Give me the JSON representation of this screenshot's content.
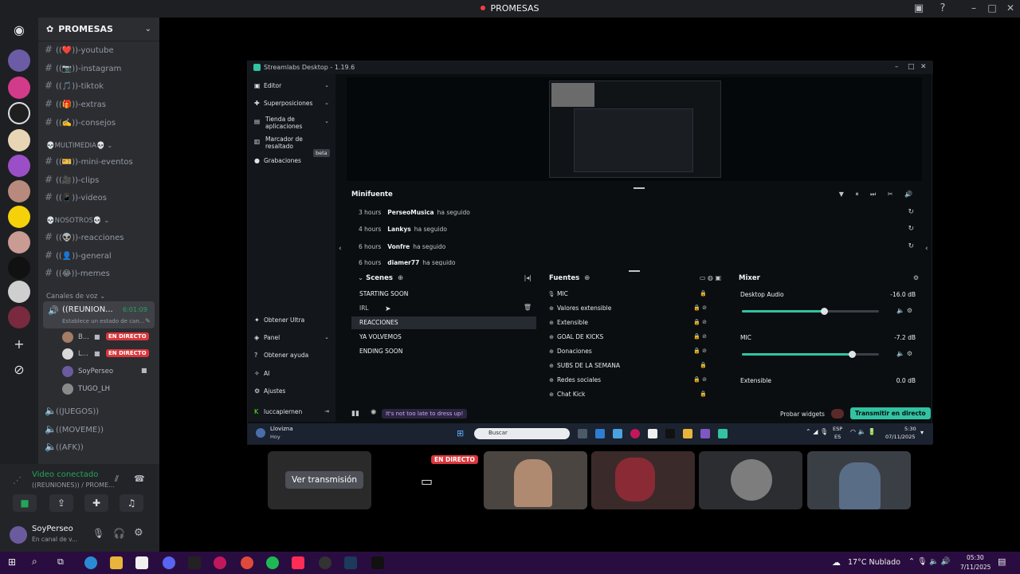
{
  "titlebar": {
    "title": "PROMESAS"
  },
  "server": {
    "name": "PROMESAS"
  },
  "channels": {
    "top_items": [
      {
        "label": "((❤️))-youtube"
      },
      {
        "label": "((📷))-instagram"
      },
      {
        "label": "((🎵))-tiktok"
      },
      {
        "label": "((🎁))-extras"
      },
      {
        "label": "((✍️))-consejos"
      }
    ],
    "cat_multimedia": "💀MULTIMEDIA💀",
    "multimedia_items": [
      {
        "label": "((🎫))-mini-eventos"
      },
      {
        "label": "((🎥))-clips"
      },
      {
        "label": "((📱))-videos"
      }
    ],
    "cat_nosotros": "💀NOSOTROS💀",
    "nosotros_items": [
      {
        "label": "((👽))-reacciones"
      },
      {
        "label": "((👤))-general"
      },
      {
        "label": "((😂))-memes"
      }
    ],
    "cat_voice": "Canales de voz",
    "voice_active": {
      "name": "((REUNION...",
      "timer": "6:01:09",
      "status": "Establece un estado de can..."
    },
    "voice_users": [
      {
        "name": "B...",
        "badge": "EN DIRECTO"
      },
      {
        "name": "L...",
        "badge": "EN DIRECTO"
      },
      {
        "name": "SoyPerseo",
        "badge": ""
      },
      {
        "name": "TUGO_LH",
        "badge": ""
      }
    ],
    "voice_channels": [
      {
        "label": "((JUEGOS))"
      },
      {
        "label": "((MOVEME))"
      },
      {
        "label": "((AFK))"
      }
    ]
  },
  "voice_panel": {
    "title": "Video conectado",
    "subtitle": "((REUNIONES)) / PROME..."
  },
  "user_panel": {
    "name": "SoyPerseo",
    "status": "En canal de v..."
  },
  "streamlabs": {
    "title": "Streamlabs Desktop - 1.19.6",
    "nav": {
      "editor": "Editor",
      "superposiciones": "Superposiciones",
      "tienda": "Tienda de aplicaciones",
      "marcador": "Marcador de resaltado",
      "beta": "beta",
      "grabaciones": "Grabaciones",
      "obtener_ultra": "Obtener Ultra",
      "panel": "Panel",
      "ayuda": "Obtener ayuda",
      "ai": "AI",
      "ajustes": "Ajustes",
      "user": "luccapiernen"
    },
    "minifeed": {
      "title": "Minifuente",
      "rows": [
        {
          "time": "3 hours",
          "user": "PerseoMusica",
          "action": "ha seguido"
        },
        {
          "time": "4 hours",
          "user": "Lankys",
          "action": "ha seguido"
        },
        {
          "time": "6 hours",
          "user": "Vonfre",
          "action": "ha seguido"
        },
        {
          "time": "6 hours",
          "user": "diamer77",
          "action": "ha seguido"
        }
      ]
    },
    "scenes": {
      "title": "Scenes",
      "items": [
        "STARTING SOON",
        "IRL",
        "REACCIONES",
        "YA VOLVEMOS",
        "ENDING SOON"
      ]
    },
    "sources": {
      "title": "Fuentes",
      "items": [
        "MIC",
        "Valores extensible",
        "Extensible",
        "GOAL DE KICKS",
        "Donaciones",
        "SUBS DE LA SEMANA",
        "Redes sociales",
        "Chat Kick"
      ]
    },
    "mixer": {
      "title": "Mixer",
      "channels": [
        {
          "name": "Desktop Audio",
          "db": "-16.0 dB",
          "level": 0.6
        },
        {
          "name": "MIC",
          "db": "-7.2 dB",
          "level": 0.8
        },
        {
          "name": "Extensible",
          "db": "0.0 dB",
          "level": 1.0
        }
      ]
    },
    "footer": {
      "tip": "It's not too late to dress up!",
      "probar": "Probar widgets",
      "golive": "Transmitir en directo"
    },
    "inner_taskbar": {
      "weather_title": "Llovizna",
      "weather_sub": "Hoy",
      "search": "Buscar",
      "lang1": "ESP",
      "lang2": "ES",
      "time": "5:30",
      "date": "07/11/2025"
    }
  },
  "tiles": {
    "ver_transmision": "Ver transmisión",
    "live_badge": "EN DIRECTO"
  },
  "taskbar": {
    "weather": "17°C  Nublado",
    "time": "05:30",
    "date": "7/11/2025"
  }
}
